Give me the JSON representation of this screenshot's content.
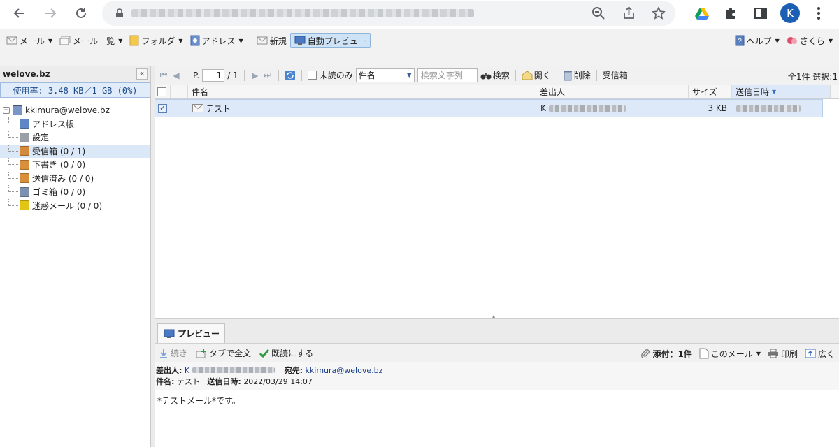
{
  "browser": {
    "avatar_letter": "K"
  },
  "menu": {
    "mail": "メール",
    "mail_list": "メール一覧",
    "folder": "フォルダ",
    "address": "アドレス",
    "new": "新規",
    "auto_preview": "自動プレビュー",
    "help": "ヘルプ",
    "user": "さくら"
  },
  "sidebar": {
    "domain": "welove.bz",
    "usage": "使用率: 3.48 KB／1 GB (0%)",
    "account": "kkimura@welove.bz",
    "items": [
      {
        "label": "アドレス帳",
        "icon": "address-book-icon",
        "color": "#5f87c7"
      },
      {
        "label": "設定",
        "icon": "gear-icon",
        "color": "#9aa0a6"
      },
      {
        "label": "受信箱 (0 / 1)",
        "icon": "inbox-icon",
        "color": "#d48a3a"
      },
      {
        "label": "下書き (0 / 0)",
        "icon": "drafts-icon",
        "color": "#d9903d"
      },
      {
        "label": "送信済み (0 / 0)",
        "icon": "sent-icon",
        "color": "#d9903d"
      },
      {
        "label": "ゴミ箱 (0 / 0)",
        "icon": "trash-icon",
        "color": "#7c90b0"
      },
      {
        "label": "迷惑メール (0 / 0)",
        "icon": "spam-icon",
        "color": "#e3c516"
      }
    ]
  },
  "list_toolbar": {
    "page_prefix": "P.",
    "page_value": "1",
    "page_total": "/ 1",
    "unread_only": "未読のみ",
    "field": "件名",
    "search_placeholder": "検索文字列",
    "search": "検索",
    "open": "開く",
    "delete": "削除",
    "folder_name": "受信箱",
    "summary": "全1件 選択:1"
  },
  "grid": {
    "columns": [
      "件名",
      "差出人",
      "サイズ",
      "送信日時"
    ],
    "rows": [
      {
        "subject": "テスト",
        "from_initial": "K",
        "size": "3 KB"
      }
    ]
  },
  "preview": {
    "tab": "プレビュー",
    "continue": "続き",
    "full_text_tab": "タブで全文",
    "mark_read": "既読にする",
    "attachments": "添付：1件",
    "this_mail": "このメール",
    "print": "印刷",
    "expand": "広く",
    "from_label": "差出人:",
    "from_initial": "K",
    "to_label": "宛先:",
    "to_value": "kkimura@welove.bz",
    "subject_label": "件名:",
    "subject_value": "テスト",
    "date_label": "送信日時:",
    "date_value": "2022/03/29 14:07",
    "body": "*テストメール*です。"
  }
}
